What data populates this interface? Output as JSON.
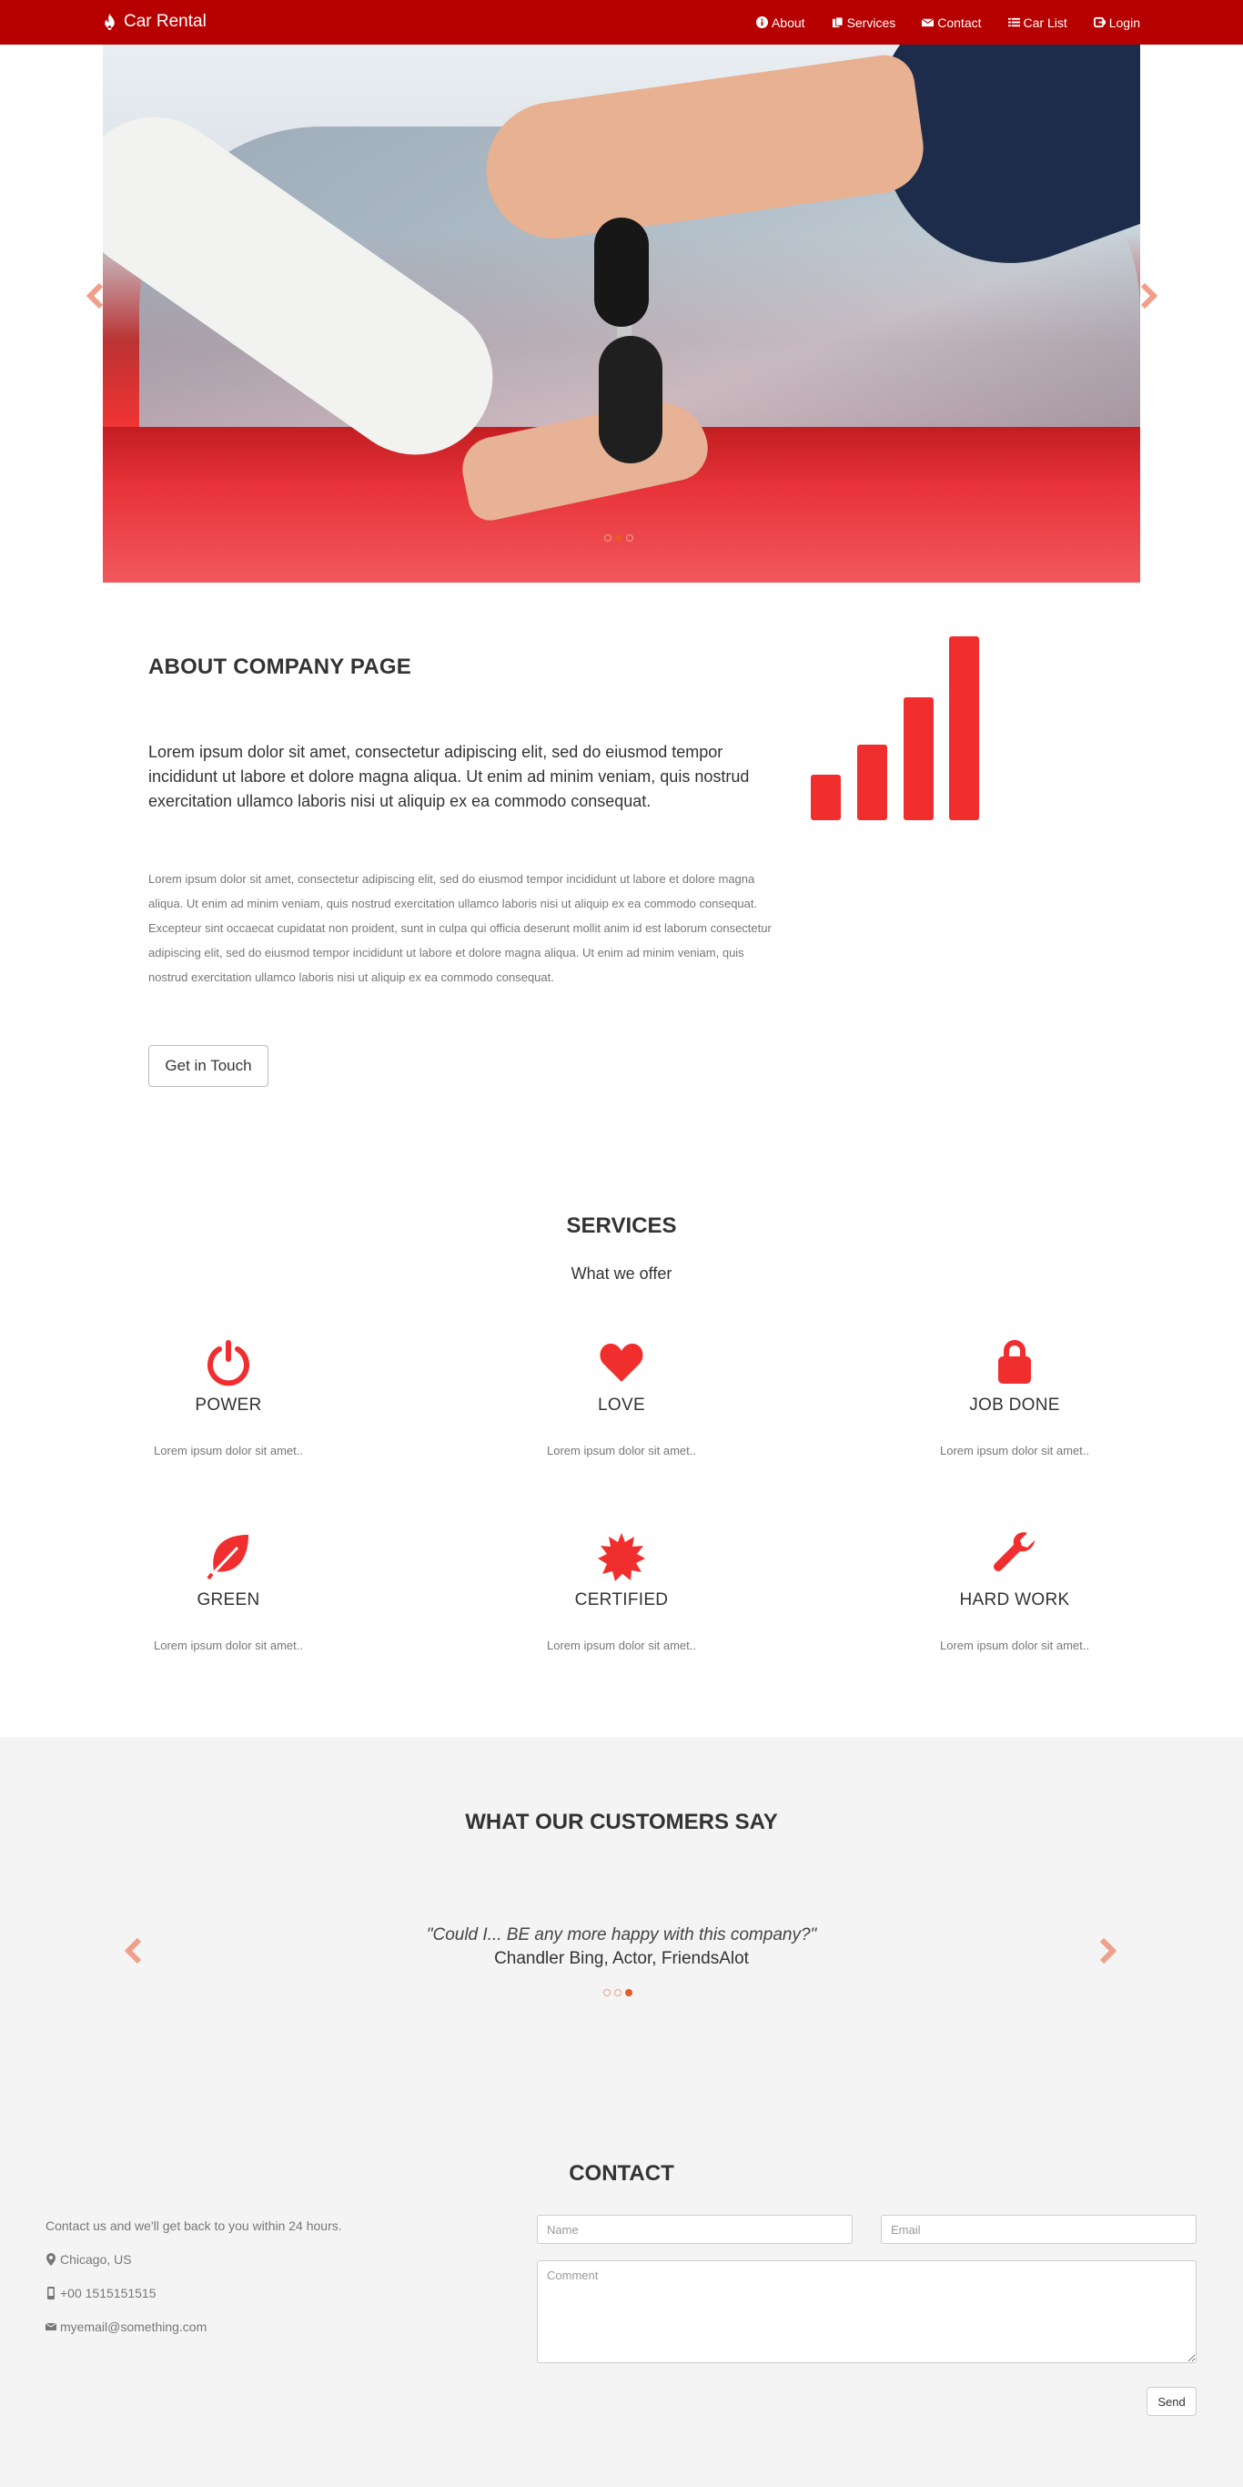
{
  "brand": {
    "name": "Car Rental",
    "icon": "fire-icon"
  },
  "nav": [
    {
      "label": "About",
      "icon": "info-icon"
    },
    {
      "label": "Services",
      "icon": "documents-icon"
    },
    {
      "label": "Contact",
      "icon": "envelope-icon"
    },
    {
      "label": "Car List",
      "icon": "list-icon"
    },
    {
      "label": "Login",
      "icon": "login-icon"
    }
  ],
  "hero": {
    "slide_count": 3,
    "active_slide": 2
  },
  "about": {
    "title": "ABOUT COMPANY PAGE",
    "lead": "Lorem ipsum dolor sit amet, consectetur adipiscing elit, sed do eiusmod tempor incididunt ut labore et dolore magna aliqua. Ut enim ad minim veniam, quis nostrud exercitation ullamco laboris nisi ut aliquip ex ea commodo consequat.",
    "body": "Lorem ipsum dolor sit amet, consectetur adipiscing elit, sed do eiusmod tempor incididunt ut labore et dolore magna aliqua. Ut enim ad minim veniam, quis nostrud exercitation ullamco laboris nisi ut aliquip ex ea commodo consequat. Excepteur sint occaecat cupidatat non proident, sunt in culpa qui officia deserunt mollit anim id est laborum consectetur adipiscing elit, sed do eiusmod tempor incididunt ut labore et dolore magna aliqua. Ut enim ad minim veniam, quis nostrud exercitation ullamco laboris nisi ut aliquip ex ea commodo consequat.",
    "button": "Get in Touch",
    "icon": "signal-icon",
    "accent": "#f12e2e"
  },
  "services": {
    "title": "SERVICES",
    "subtitle": "What we offer",
    "items": [
      {
        "name": "POWER",
        "desc": "Lorem ipsum dolor sit amet..",
        "icon": "power-icon"
      },
      {
        "name": "LOVE",
        "desc": "Lorem ipsum dolor sit amet..",
        "icon": "heart-icon"
      },
      {
        "name": "JOB DONE",
        "desc": "Lorem ipsum dolor sit amet..",
        "icon": "lock-icon"
      },
      {
        "name": "GREEN",
        "desc": "Lorem ipsum dolor sit amet..",
        "icon": "leaf-icon"
      },
      {
        "name": "CERTIFIED",
        "desc": "Lorem ipsum dolor sit amet..",
        "icon": "certificate-icon"
      },
      {
        "name": "HARD WORK",
        "desc": "Lorem ipsum dolor sit amet..",
        "icon": "wrench-icon"
      }
    ]
  },
  "testimonials": {
    "title": "WHAT OUR CUSTOMERS SAY",
    "quote": "\"Could I... BE any more happy with this company?\"",
    "author": "Chandler Bing, Actor, FriendsAlot",
    "slide_count": 3,
    "active_slide": 3
  },
  "contact": {
    "title": "CONTACT",
    "intro": "Contact us and we'll get back to you within 24 hours.",
    "location": "Chicago, US",
    "phone": "+00 1515151515",
    "email": "myemail@something.com",
    "name_placeholder": "Name",
    "email_placeholder": "Email",
    "comment_placeholder": "Comment",
    "send": "Send"
  },
  "colors": {
    "navbar": "#b70000",
    "accent": "#f12e2e",
    "arrow": "#f0a08a"
  }
}
